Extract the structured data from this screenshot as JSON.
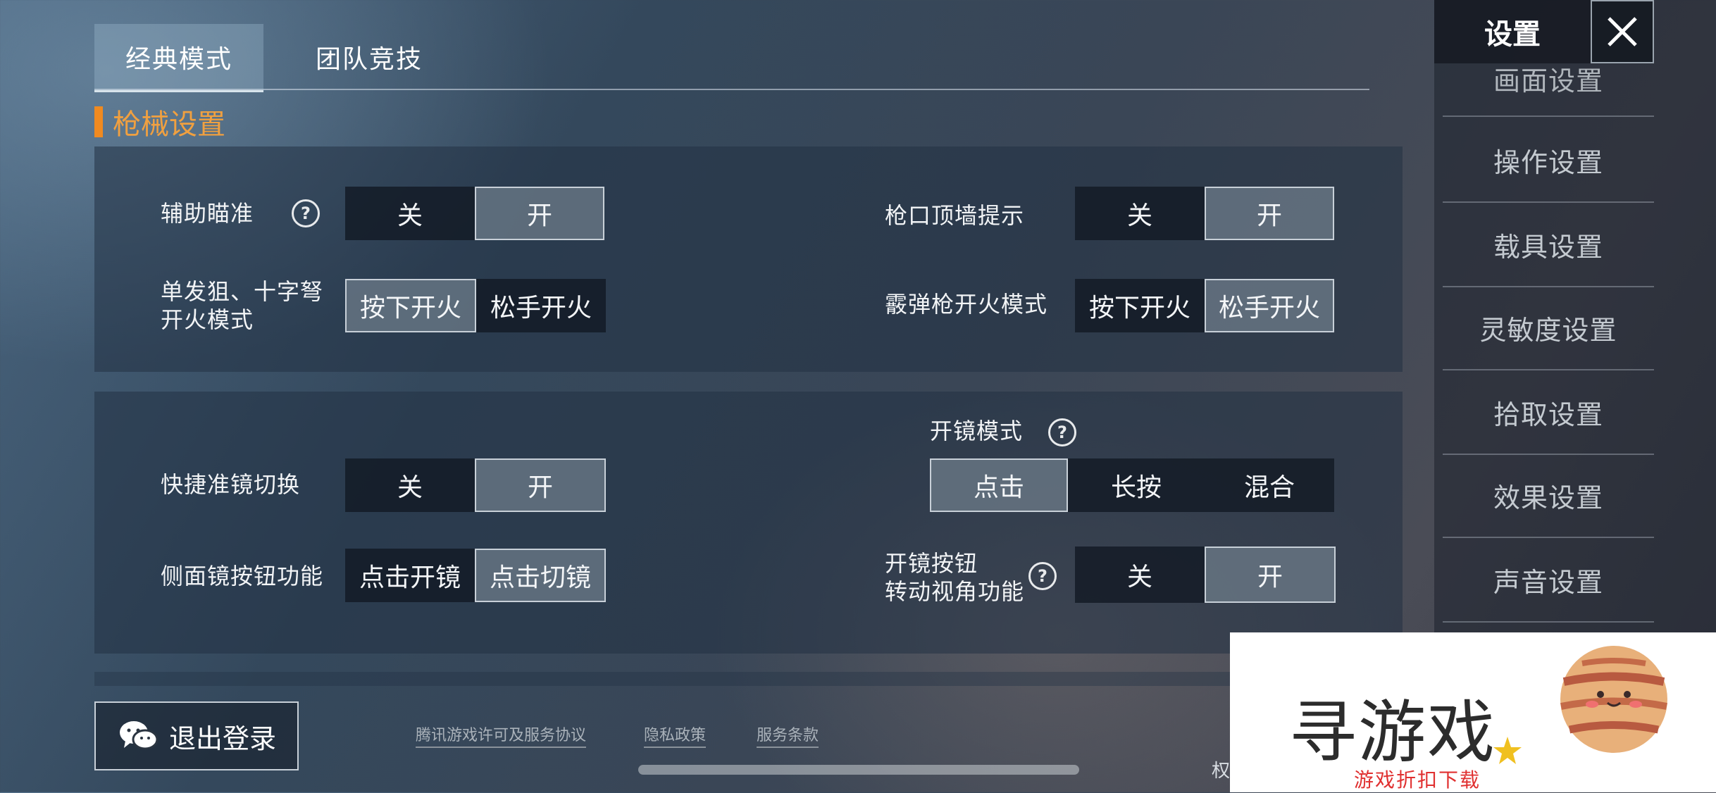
{
  "tabs": [
    {
      "label": "经典模式",
      "active": true
    },
    {
      "label": "团队竞技",
      "active": false
    }
  ],
  "section_title": "枪械设置",
  "panel1": {
    "rows": [
      {
        "label": "辅助瞄准",
        "options": [
          "关",
          "开"
        ],
        "selected": "开"
      },
      {
        "label": "枪口顶墙提示",
        "options": [
          "关",
          "开"
        ],
        "selected": "开"
      },
      {
        "label_line1": "单发狙、十字弩",
        "label_line2": "开火模式",
        "options": [
          "按下开火",
          "松手开火"
        ],
        "selected": "按下开火"
      },
      {
        "label": "霰弹枪开火模式",
        "options": [
          "按下开火",
          "松手开火"
        ],
        "selected": "松手开火"
      }
    ]
  },
  "panel2": {
    "rows": [
      {
        "label": "快捷准镜切换",
        "options": [
          "关",
          "开"
        ],
        "selected": "开"
      },
      {
        "label": "开镜模式",
        "options": [
          "点击",
          "长按",
          "混合"
        ],
        "selected": "点击"
      },
      {
        "label": "侧面镜按钮功能",
        "options": [
          "点击开镜",
          "点击切镜"
        ],
        "selected": "点击切镜"
      },
      {
        "label_line1": "开镜按钮",
        "label_line2": "转动视角功能",
        "options": [
          "关",
          "开"
        ],
        "selected": "开"
      }
    ]
  },
  "sidebar": {
    "title": "设置",
    "items": [
      "画面设置",
      "操作设置",
      "载具设置",
      "灵敏度设置",
      "拾取设置",
      "效果设置",
      "声音设置"
    ]
  },
  "footer": {
    "logout": "退出登录",
    "links": [
      "腾讯游戏许可及服务协议",
      "隐私政策",
      "服务条款"
    ],
    "partial_text": "权"
  },
  "watermark": {
    "title": "寻游戏",
    "subtitle": "游戏折扣下载"
  },
  "colors": {
    "accent": "#f08a20",
    "selected_bg": "#6e7c8a",
    "option_bg": "#121a24"
  },
  "icons": [
    "question-mark-icon",
    "close-icon",
    "wechat-icon",
    "planet-mascot-icon",
    "star-icon"
  ]
}
